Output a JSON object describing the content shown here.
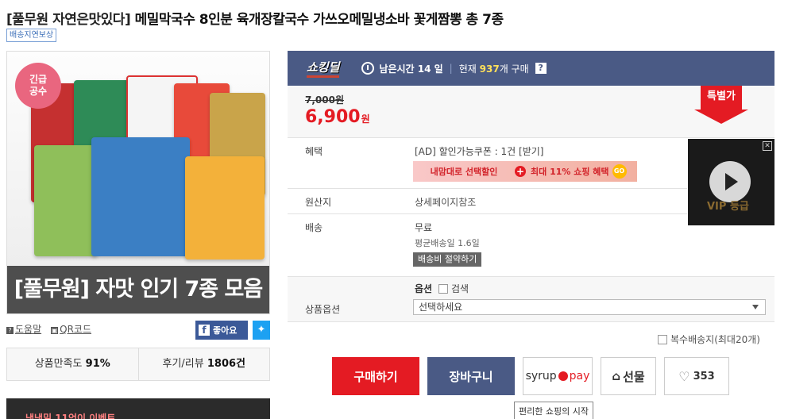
{
  "title": {
    "brand": "[풀무원 자연은맛있다]",
    "name": "메밀막국수 8인분 육개장칼국수 가쓰오메밀냉소바 꽃게짬뽕 총 7종"
  },
  "shipping_badge": "배송지연보상",
  "image": {
    "badge_line1": "긴급",
    "badge_line2": "공수",
    "caption": "[풀무원] 자맛 인기 7종 모음"
  },
  "links": {
    "help": "도움말",
    "qr": "QR코드"
  },
  "social": {
    "like": "좋아요"
  },
  "stats": {
    "satisfaction_label": "상품만족도",
    "satisfaction_value": "91%",
    "reviews_label": "후기/리뷰",
    "reviews_value": "1806건"
  },
  "promo_strip_text": "냉냉밀 11억이 이벤트",
  "deal_bar": {
    "logo": "쇼킹딜",
    "remaining": "남은시간 14 일",
    "current_prefix": "현재",
    "current_count": "937",
    "current_suffix": "개 구매",
    "help": "?"
  },
  "price": {
    "original": "7,000원",
    "sale": "6,900",
    "sale_unit": "원",
    "special_tag": "특별가"
  },
  "benefit": {
    "label": "혜택",
    "coupon": "[AD] 할인가능쿠폰 : 1건 [받기]",
    "banner_left": "내맘대로 선택할인",
    "banner_right": "최대 11% 쇼핑 혜택",
    "banner_go": "GO"
  },
  "origin": {
    "label": "원산지",
    "value": "상세페이지참조"
  },
  "shipping": {
    "label": "배송",
    "fee": "무료",
    "avg": "평균배송일 1.6일",
    "save_button": "배송비 절약하기"
  },
  "options": {
    "row_label": "상품옵션",
    "header": "옵션",
    "search_label": "검색",
    "select_value": "선택하세요"
  },
  "multi_address": "복수배송지(최대20개)",
  "buttons": {
    "buy": "구매하기",
    "cart": "장바구니",
    "syrup": "syrup",
    "pay": "pay",
    "gift": "선물",
    "like_count": "353"
  },
  "tooltip": "편리한 쇼핑의 시작",
  "vip_ad": {
    "text": "VIP 등급"
  },
  "colors": {
    "accent_red": "#e41b23",
    "deal_bar": "#4a5a85"
  }
}
